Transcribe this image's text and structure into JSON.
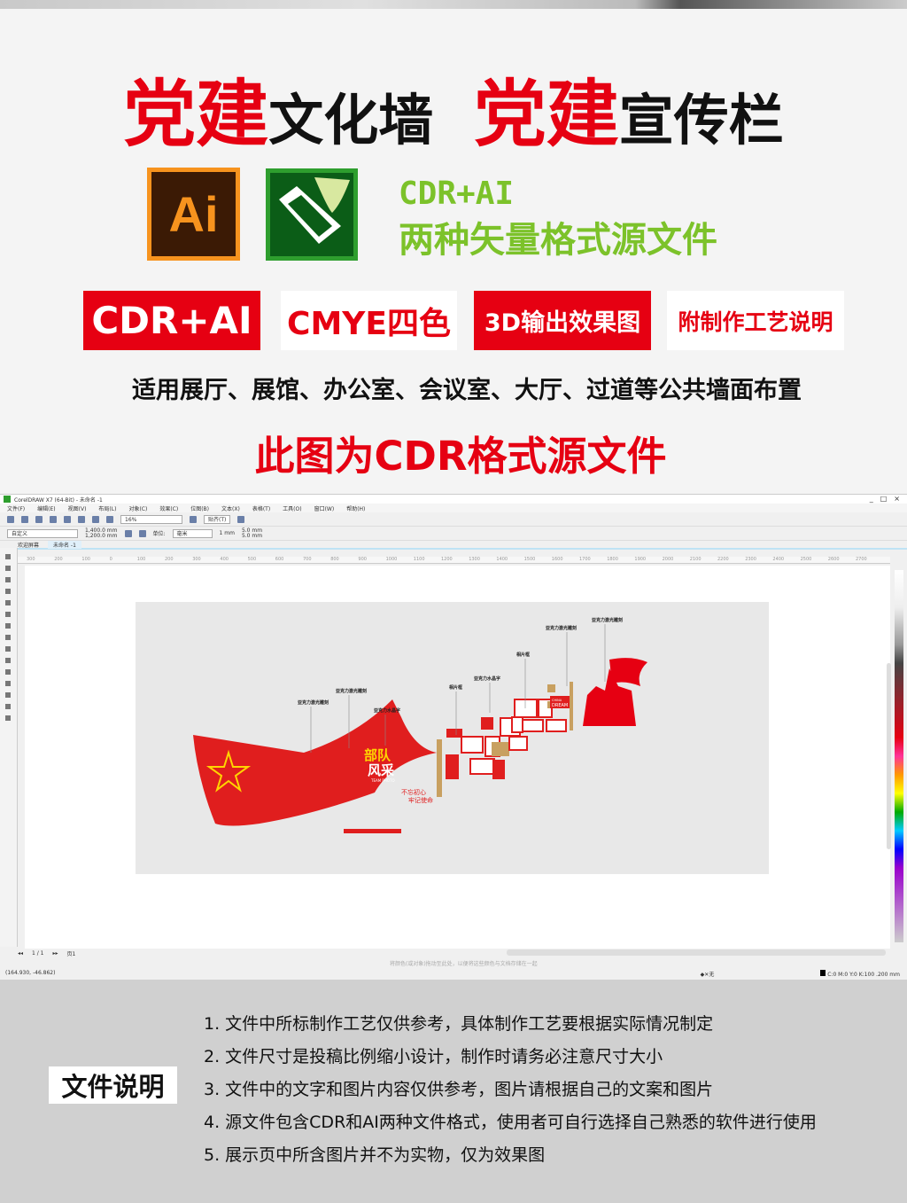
{
  "header": {
    "title_red_1": "党建",
    "title_black_1": "文化墙",
    "title_red_2": "党建",
    "title_black_2": "宣传栏"
  },
  "formats": {
    "ai_icon_text": "Ai",
    "line1": "CDR+AI",
    "line2": "两种矢量格式源文件"
  },
  "badges": [
    "CDR+AI",
    "CMYE四色",
    "3D输出效果图",
    "附制作工艺说明"
  ],
  "usage": "适用展厅、展馆、办公室、会议室、大厅、过道等公共墙面布置",
  "notice": "此图为CDR格式源文件",
  "app": {
    "title": "CorelDRAW X7 (64-Bit) - 未命名 -1",
    "window_controls": [
      "_",
      "□",
      "×"
    ],
    "menu": [
      "文件(F)",
      "编辑(E)",
      "视图(V)",
      "布局(L)",
      "对象(C)",
      "效果(C)",
      "位图(B)",
      "文本(X)",
      "表格(T)",
      "工具(O)",
      "窗口(W)",
      "帮助(H)"
    ],
    "zoom": "16%",
    "snap": "贴齐(T)",
    "page_preset": "自定义",
    "width": "1,400.0 mm",
    "height": "1,200.0 mm",
    "unit_label": "单位:",
    "unit": "毫米",
    "nudge": "1 mm",
    "dup_x": "5.0 mm",
    "dup_y": "5.0 mm",
    "tabs": [
      "欢迎屏幕",
      "未命名 -1"
    ],
    "ruler_ticks": [
      "300",
      "200",
      "100",
      "0",
      "100",
      "200",
      "300",
      "400",
      "500",
      "600",
      "700",
      "800",
      "900",
      "1000",
      "1100",
      "1200",
      "1300",
      "1400",
      "1500",
      "1600",
      "1700",
      "1800",
      "1900",
      "2000",
      "2100",
      "2200",
      "2300",
      "2400",
      "2500",
      "2600",
      "2700"
    ],
    "page_indicator": "1 / 1",
    "page_tab": "页1",
    "hint": "将颜色(或对象)拖动至此处，以便将这些颜色与文档存储在一起",
    "coords": "(164.930, -46.862)",
    "fill_status": "无",
    "outline_status": "C:0 M:0 Y:0 K:100  .200 mm",
    "artwork": {
      "labels": [
        "亚克力激光雕刻",
        "亚克力激光雕刻",
        "亚克力水晶字",
        "相片框",
        "亚克力水晶字",
        "相片框",
        "亚克力激光雕刻",
        "亚克力激光雕刻"
      ],
      "flag_title_1": "部队",
      "flag_title_2": "风采",
      "flag_sub": "TEAM PHOTO",
      "slogan_1": "不忘初心",
      "slogan_2": "牢记使命",
      "dream_1": "CHINA",
      "dream_2": "DREAM"
    }
  },
  "file_notes": {
    "label": "文件说明",
    "items": [
      "1. 文件中所标制作工艺仅供参考，具体制作工艺要根据实际情况制定",
      "2. 文件尺寸是投稿比例缩小设计，制作时请务必注意尺寸大小",
      "3. 文件中的文字和图片内容仅供参考，图片请根据自己的文案和图片",
      "4. 源文件包含CDR和AI两种文件格式，使用者可自行选择自己熟悉的软件进行使用",
      "5. 展示页中所含图片并不为实物，仅为效果图"
    ]
  },
  "colors": {
    "brand_red": "#e60012",
    "green": "#7cc22a",
    "ai_orange": "#f7931e",
    "cdr_green": "#2e9e2e"
  }
}
